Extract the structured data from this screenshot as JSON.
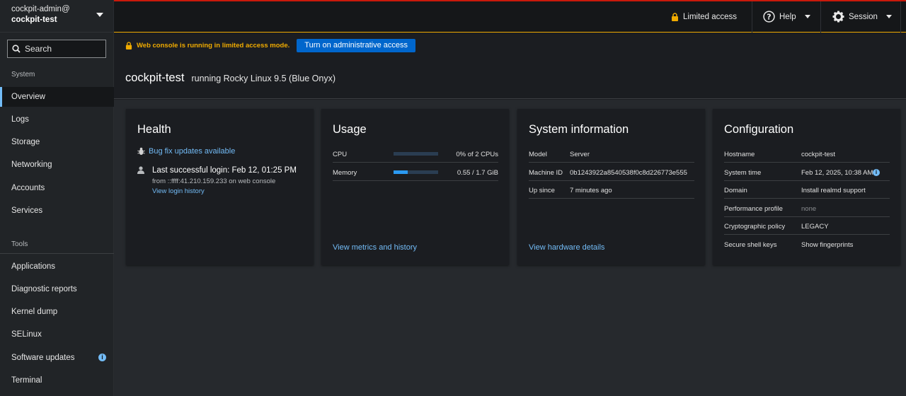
{
  "host": {
    "user": "cockpit-admin@",
    "name": "cockpit-test"
  },
  "search": {
    "placeholder": "Search"
  },
  "nav": {
    "system_label": "System",
    "tools_label": "Tools",
    "system_items": [
      "Overview",
      "Logs",
      "Storage",
      "Networking",
      "Accounts",
      "Services"
    ],
    "tool_items": [
      "Applications",
      "Diagnostic reports",
      "Kernel dump",
      "SELinux",
      "Software updates",
      "Terminal"
    ],
    "active": "Overview"
  },
  "topbar": {
    "limited_access": "Limited access",
    "help": "Help",
    "session": "Session"
  },
  "alert": {
    "message": "Web console is running in limited access mode.",
    "button": "Turn on administrative access"
  },
  "page": {
    "title": "cockpit-test",
    "subtitle": "running Rocky Linux 9.5 (Blue Onyx)"
  },
  "health": {
    "title": "Health",
    "updates_link": "Bug fix updates available",
    "last_login": "Last successful login: Feb 12, 01:25 PM",
    "login_from": "from ::ffff:41.210.159.233 on web console",
    "history_link": "View login history"
  },
  "usage": {
    "title": "Usage",
    "rows": [
      {
        "label": "CPU",
        "value": "0% of 2 CPUs",
        "fraction": 0.0
      },
      {
        "label": "Memory",
        "value": "0.55 / 1.7 GiB",
        "fraction": 0.32
      }
    ],
    "link": "View metrics and history"
  },
  "sysinfo": {
    "title": "System information",
    "rows": [
      {
        "label": "Model",
        "value": "Server"
      },
      {
        "label": "Machine ID",
        "value": "0b1243922a8540538f0c8d226773e555"
      },
      {
        "label": "Up since",
        "value": "7 minutes ago"
      }
    ],
    "link": "View hardware details"
  },
  "config": {
    "title": "Configuration",
    "rows": [
      {
        "label": "Hostname",
        "value": "cockpit-test"
      },
      {
        "label": "System time",
        "value": "Feb 12, 2025, 10:38 AM"
      },
      {
        "label": "Domain",
        "value": "Install realmd support"
      },
      {
        "label": "Performance profile",
        "value": "none"
      },
      {
        "label": "Cryptographic policy",
        "value": "LEGACY"
      },
      {
        "label": "Secure shell keys",
        "value": "Show fingerprints"
      }
    ]
  },
  "colors": {
    "accent": "#73bcf7",
    "warning": "#f0ab00",
    "primary_button": "#0066cc"
  }
}
